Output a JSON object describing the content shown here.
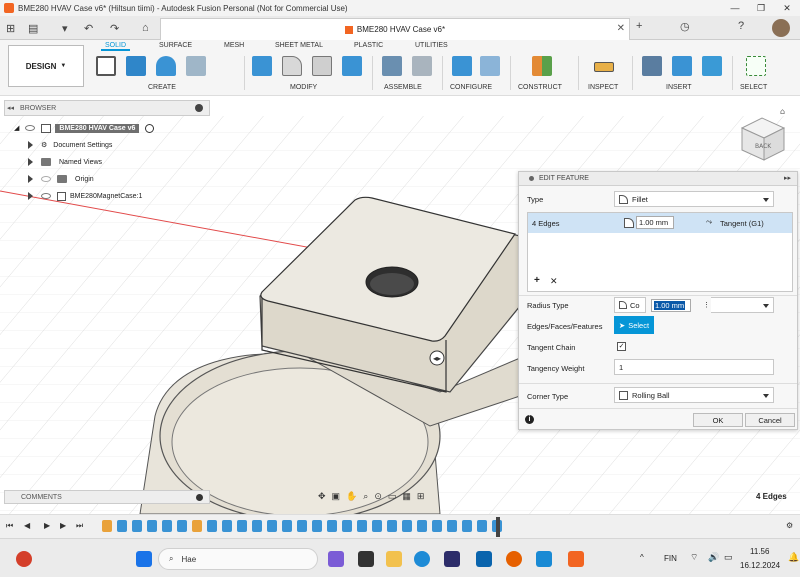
{
  "window": {
    "title": "BME280 HVAV Case v6* (Hiltsun tiimi) - Autodesk Fusion Personal (Not for Commercial Use)",
    "minimize": "—",
    "restore": "❐",
    "close": "✕"
  },
  "quick_access": {
    "file": "▤",
    "save": "▾",
    "undo": "↶",
    "redo": "↷",
    "home": "⌂"
  },
  "doc_tab": {
    "label": "BME280 HVAV Case v6*",
    "close": "✕"
  },
  "tab_right": {
    "add": "+",
    "clock": "◷",
    "bell": "🔔",
    "help": "?"
  },
  "ribbon": {
    "workspace": "DESIGN",
    "tabs": [
      "SOLID",
      "SURFACE",
      "MESH",
      "SHEET METAL",
      "PLASTIC",
      "UTILITIES"
    ],
    "active_tab": "SOLID",
    "groups": [
      "CREATE",
      "MODIFY",
      "ASSEMBLE",
      "CONFIGURE",
      "CONSTRUCT",
      "INSPECT",
      "INSERT",
      "SELECT"
    ]
  },
  "browser": {
    "header": "BROWSER",
    "root": "BME280 HVAV Case v6",
    "items": [
      "Document Settings",
      "Named Views",
      "Origin",
      "BME280MagnetCase:1"
    ]
  },
  "edit_feature": {
    "header": "EDIT FEATURE",
    "type_label": "Type",
    "type_value": "Fillet",
    "edge_row_label": "4 Edges",
    "edge_row_value": "1.00 mm",
    "edge_row_continuity": "Tangent (G1)",
    "add_symbol": "+",
    "remove_symbol": "✕",
    "radius_type_label": "Radius Type",
    "radius_type_short": "Co",
    "radius_type_value": "1.00 mm",
    "edges_label": "Edges/Faces/Features",
    "select_button": "Select",
    "tangent_chain_label": "Tangent Chain",
    "tangent_chain_checked": "✓",
    "tangency_weight_label": "Tangency Weight",
    "tangency_weight_value": "1",
    "corner_type_label": "Corner Type",
    "corner_type_value": "Rolling Ball",
    "info_symbol": "i",
    "ok": "OK",
    "cancel": "Cancel"
  },
  "comments": {
    "header": "COMMENTS"
  },
  "status": {
    "selection": "4 Edges"
  },
  "viewcube": {
    "face": "BACK"
  },
  "taskbar": {
    "search_placeholder": "Hae",
    "language": "FIN",
    "time": "11.56",
    "date": "16.12.2024"
  },
  "colors": {
    "accent": "#0696d7",
    "fusion_orange": "#f26522",
    "model_fill": "#e6e2d8",
    "selection_row": "#cfe3f5"
  }
}
